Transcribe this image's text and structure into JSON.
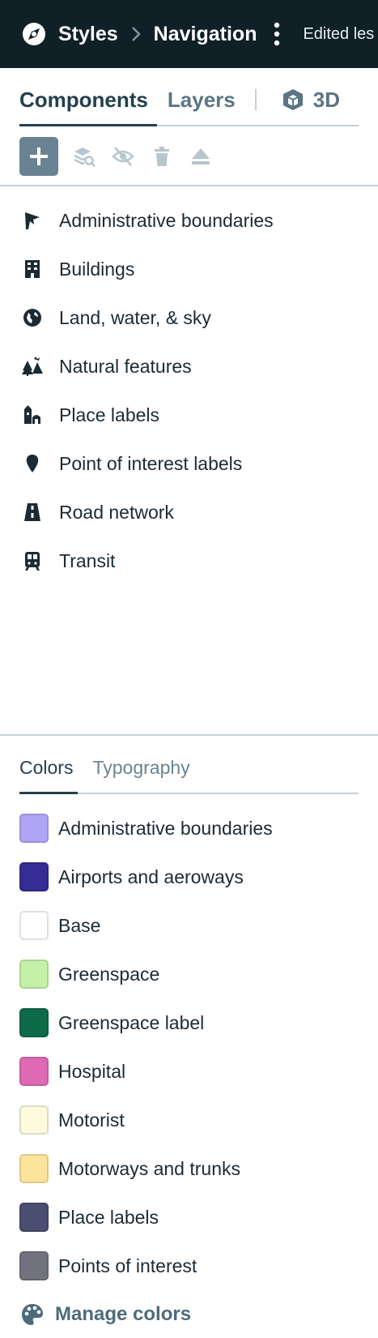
{
  "header": {
    "styles_label": "Styles",
    "navigation_label": "Navigation",
    "status": "Edited les",
    "logo_icon": "compass-logo-icon",
    "separator_icon": "chevron-right-icon",
    "menu_icon": "kebab-menu-icon"
  },
  "tabs": {
    "components": "Components",
    "layers": "Layers",
    "three_d": "3D"
  },
  "toolbar": {
    "icons": [
      "add-icon",
      "layer-search-icon",
      "eye-off-icon",
      "trash-icon",
      "eject-icon"
    ]
  },
  "components": [
    {
      "label": "Administrative boundaries",
      "icon": "flag-icon"
    },
    {
      "label": "Buildings",
      "icon": "building-icon"
    },
    {
      "label": "Land, water, & sky",
      "icon": "globe-icon"
    },
    {
      "label": "Natural features",
      "icon": "trees-mountain-icon"
    },
    {
      "label": "Place labels",
      "icon": "place-icon"
    },
    {
      "label": "Point of interest labels",
      "icon": "map-pin-icon"
    },
    {
      "label": "Road network",
      "icon": "road-icon"
    },
    {
      "label": "Transit",
      "icon": "train-icon"
    }
  ],
  "subtabs": {
    "colors": "Colors",
    "typography": "Typography"
  },
  "colors": [
    {
      "label": "Administrative boundaries",
      "color": "#b0a4f5"
    },
    {
      "label": "Airports and aeroways",
      "color": "#352d94"
    },
    {
      "label": "Base",
      "color": "#ffffff"
    },
    {
      "label": "Greenspace",
      "color": "#c5f0a8"
    },
    {
      "label": "Greenspace label",
      "color": "#0f6a4a"
    },
    {
      "label": "Hospital",
      "color": "#de6ab4"
    },
    {
      "label": "Motorist",
      "color": "#fdfbdc"
    },
    {
      "label": "Motorways and trunks",
      "color": "#fde49d"
    },
    {
      "label": "Place labels",
      "color": "#4a4e70"
    },
    {
      "label": "Points of interest",
      "color": "#72727e"
    }
  ],
  "manage_colors": {
    "label": "Manage colors",
    "icon": "palette-icon"
  },
  "theme": {
    "header_bg": "#0f2027",
    "accent": "#24404f",
    "muted": "#5b7585"
  }
}
